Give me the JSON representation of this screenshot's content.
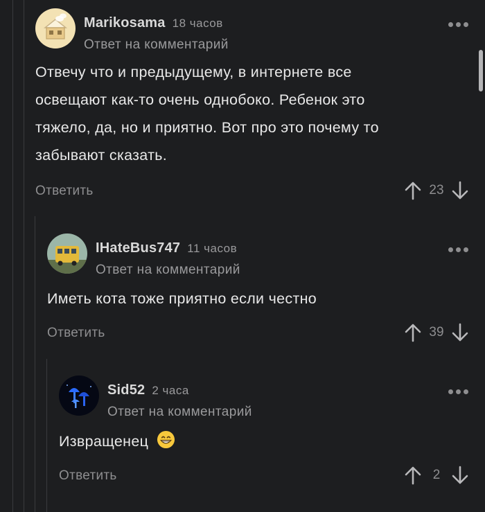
{
  "comments": [
    {
      "username": "Marikosama",
      "time": "18 часов",
      "reply_to": "Ответ на комментарий",
      "text_lines": [
        "Отвечу что и  предыдущему, в интернете все",
        "освещают как-то очень однобоко. Ребенок это",
        "тяжело, да, но и приятно. Вот про это почему то",
        "забывают сказать."
      ],
      "reply_label": "Ответить",
      "rating": "23",
      "avatar_icon": "house-avatar-icon"
    },
    {
      "username": "IHateBus747",
      "time": "11 часов",
      "reply_to": "Ответ на комментарий",
      "text": "Иметь кота тоже приятно если честно",
      "reply_label": "Ответить",
      "rating": "39",
      "avatar_icon": "bus-avatar-icon"
    },
    {
      "username": "Sid52",
      "time": "2 часа",
      "reply_to": "Ответ на комментарий",
      "text": "Извращенец",
      "emoji": "grinning-face-emoji",
      "reply_label": "Ответить",
      "rating": "2",
      "avatar_icon": "blue-mushrooms-avatar-icon"
    }
  ],
  "colors": {
    "background": "#1d1e20",
    "text": "#e8e8e8",
    "muted": "#9a9a9c",
    "thread_line": "#3a3b3e"
  }
}
